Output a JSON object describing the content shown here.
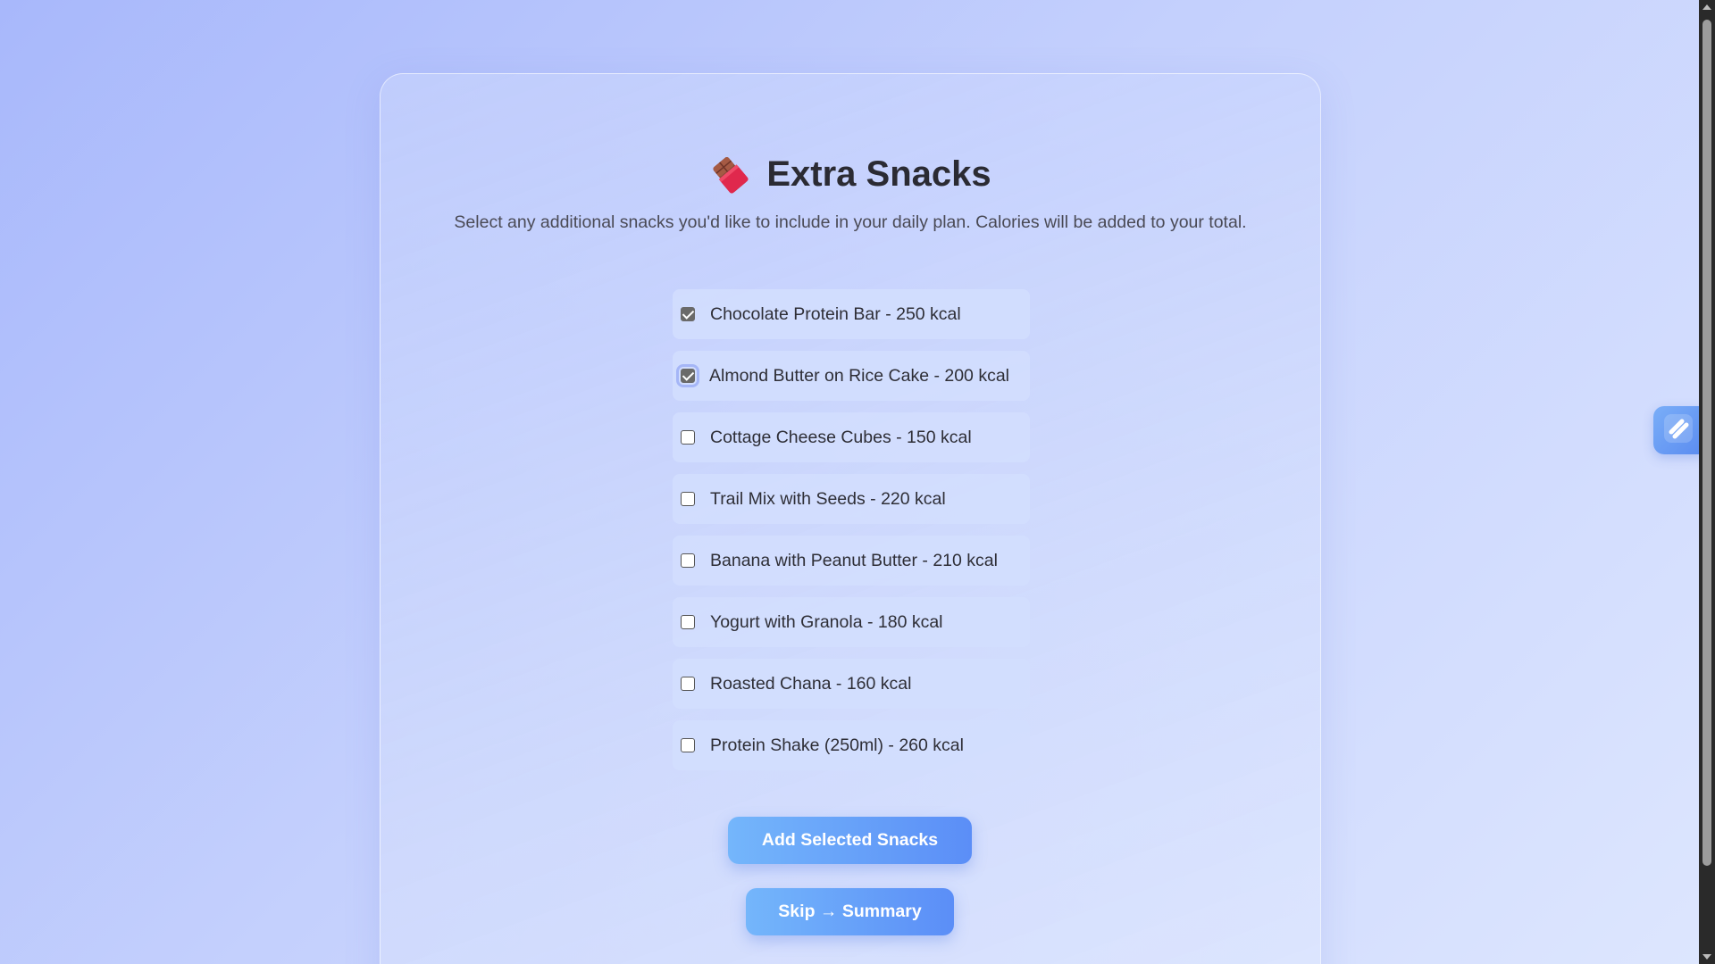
{
  "header": {
    "icon": "chocolate-bar-icon",
    "title": "Extra Snacks",
    "subtitle": "Select any additional snacks you'd like to include in your daily plan. Calories will be added to your total."
  },
  "snacks": [
    {
      "label": "Chocolate Protein Bar - 250 kcal",
      "checked": true
    },
    {
      "label": "Almond Butter on Rice Cake - 200 kcal",
      "checked": true,
      "focused": true
    },
    {
      "label": "Cottage Cheese Cubes - 150 kcal",
      "checked": false
    },
    {
      "label": "Trail Mix with Seeds - 220 kcal",
      "checked": false
    },
    {
      "label": "Banana with Peanut Butter - 210 kcal",
      "checked": false
    },
    {
      "label": "Yogurt with Granola - 180 kcal",
      "checked": false
    },
    {
      "label": "Roasted Chana - 160 kcal",
      "checked": false
    },
    {
      "label": "Protein Shake (250ml) - 260 kcal",
      "checked": false
    }
  ],
  "actions": {
    "add_label": "Add Selected Snacks",
    "skip_label": "Skip → Summary"
  },
  "floating": {
    "icon": "slash-logo-icon"
  },
  "colors": {
    "button_gradient_start": "#74b6fb",
    "button_gradient_end": "#5b8ef7",
    "title": "#2b2b33"
  }
}
